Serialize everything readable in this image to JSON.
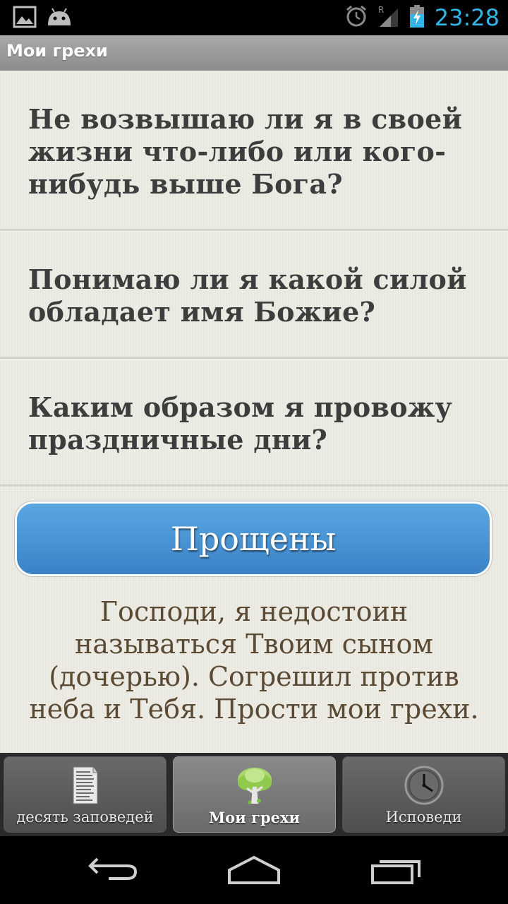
{
  "status_bar": {
    "time": "23:28",
    "icons": [
      "gallery-icon",
      "android-icon",
      "alarm-icon",
      "signal-icon",
      "battery-charging-icon"
    ],
    "roaming_indicator": "R",
    "accent_color": "#33b5e5"
  },
  "title_bar": {
    "title": "Мои грехи"
  },
  "questions": [
    {
      "text": "Не возвышаю ли я в своей жизни что-либо или кого-нибудь выше Бога?"
    },
    {
      "text": "Понимаю ли я какой силой обладает имя Божие?"
    },
    {
      "text": "Каким образом я провожу праздничные дни?"
    }
  ],
  "forgive_button": {
    "label": "Прощены",
    "color": "#4a95d6"
  },
  "prayer": {
    "text": "Господи, я недостоин называться Твоим сыном (дочерью). Согрешил против неба и Тебя. Прости мои грехи."
  },
  "tabs": [
    {
      "label": "десять заповедей",
      "icon": "commandments-tablet-icon",
      "active": false
    },
    {
      "label": "Мои грехи",
      "icon": "tree-icon",
      "active": true
    },
    {
      "label": "Исповеди",
      "icon": "clock-icon",
      "active": false
    }
  ],
  "nav_bar": {
    "buttons": [
      "back-icon",
      "home-icon",
      "recent-apps-icon"
    ]
  }
}
